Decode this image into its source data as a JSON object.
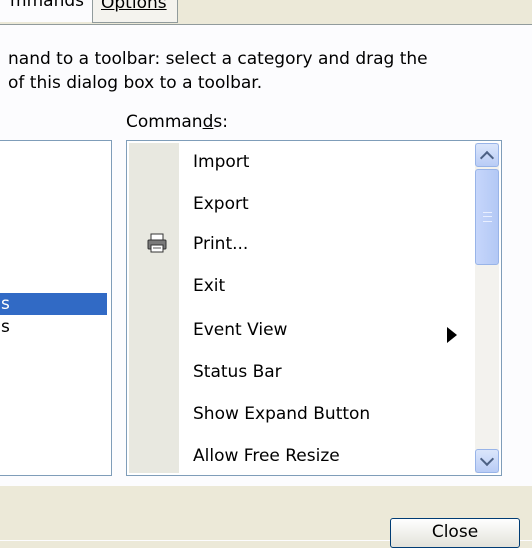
{
  "tabs": {
    "commands": "mmands",
    "options": "Options"
  },
  "instructions": {
    "line1": "nand to a toolbar: select a category and drag the",
    "line2": "of this dialog box to a toolbar."
  },
  "commands_label": {
    "before": "Comman",
    "underlined": "d",
    "after": "s:"
  },
  "categories": {
    "selected_label": "s",
    "next_label": "s"
  },
  "commands": [
    {
      "label": "Import"
    },
    {
      "label": "Export"
    },
    {
      "label": "Print...",
      "icon": "printer-icon"
    },
    {
      "label": "Exit"
    },
    {
      "label": "Event View",
      "has_submenu": true
    },
    {
      "label": "Status Bar"
    },
    {
      "label": "Show Expand Button"
    },
    {
      "label": "Allow Free Resize"
    }
  ],
  "close_button": "Close",
  "colors": {
    "dialog_bg": "#ece9d8",
    "panel_bg": "#fcfcfe",
    "selection": "#316ac5",
    "list_border": "#7f9db9"
  }
}
